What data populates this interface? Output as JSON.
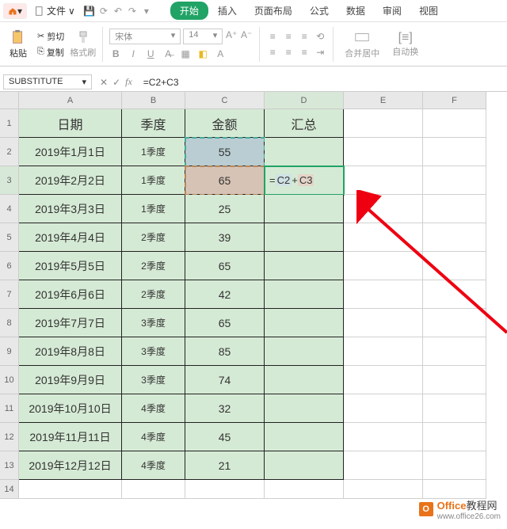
{
  "menu": {
    "file": "文件"
  },
  "tabs": {
    "start": "开始",
    "insert": "插入",
    "layout": "页面布局",
    "formula": "公式",
    "data": "数据",
    "review": "审阅",
    "view": "视图"
  },
  "ribbon": {
    "paste": "粘贴",
    "cut": "剪切",
    "copy": "复制",
    "brush": "格式刷",
    "font": "宋体",
    "size": "14",
    "merge": "合并居中",
    "autowrap": "自动换"
  },
  "namebox": "SUBSTITUTE",
  "formula": "=C2+C3",
  "cols": {
    "A": "A",
    "B": "B",
    "C": "C",
    "D": "D",
    "E": "E",
    "F": "F"
  },
  "headers": {
    "date": "日期",
    "quarter": "季度",
    "amount": "金额",
    "summary": "汇总"
  },
  "rows": [
    {
      "n": "1"
    },
    {
      "n": "2",
      "date": "2019年1月1日",
      "q": "1季度",
      "amt": "55"
    },
    {
      "n": "3",
      "date": "2019年2月2日",
      "q": "1季度",
      "amt": "65"
    },
    {
      "n": "4",
      "date": "2019年3月3日",
      "q": "1季度",
      "amt": "25"
    },
    {
      "n": "5",
      "date": "2019年4月4日",
      "q": "2季度",
      "amt": "39"
    },
    {
      "n": "6",
      "date": "2019年5月5日",
      "q": "2季度",
      "amt": "65"
    },
    {
      "n": "7",
      "date": "2019年6月6日",
      "q": "2季度",
      "amt": "42"
    },
    {
      "n": "8",
      "date": "2019年7月7日",
      "q": "3季度",
      "amt": "65"
    },
    {
      "n": "9",
      "date": "2019年8月8日",
      "q": "3季度",
      "amt": "85"
    },
    {
      "n": "10",
      "date": "2019年9月9日",
      "q": "3季度",
      "amt": "74"
    },
    {
      "n": "11",
      "date": "2019年10月10日",
      "q": "4季度",
      "amt": "32"
    },
    {
      "n": "12",
      "date": "2019年11月11日",
      "q": "4季度",
      "amt": "45"
    },
    {
      "n": "13",
      "date": "2019年12月12日",
      "q": "4季度",
      "amt": "21"
    },
    {
      "n": "14"
    }
  ],
  "edit": {
    "eq": "= ",
    "c2": "C2",
    "plus": " + ",
    "c3": "C3"
  },
  "watermark": {
    "brand": "Office",
    "rest": "教程网",
    "url": "www.office26.com"
  }
}
